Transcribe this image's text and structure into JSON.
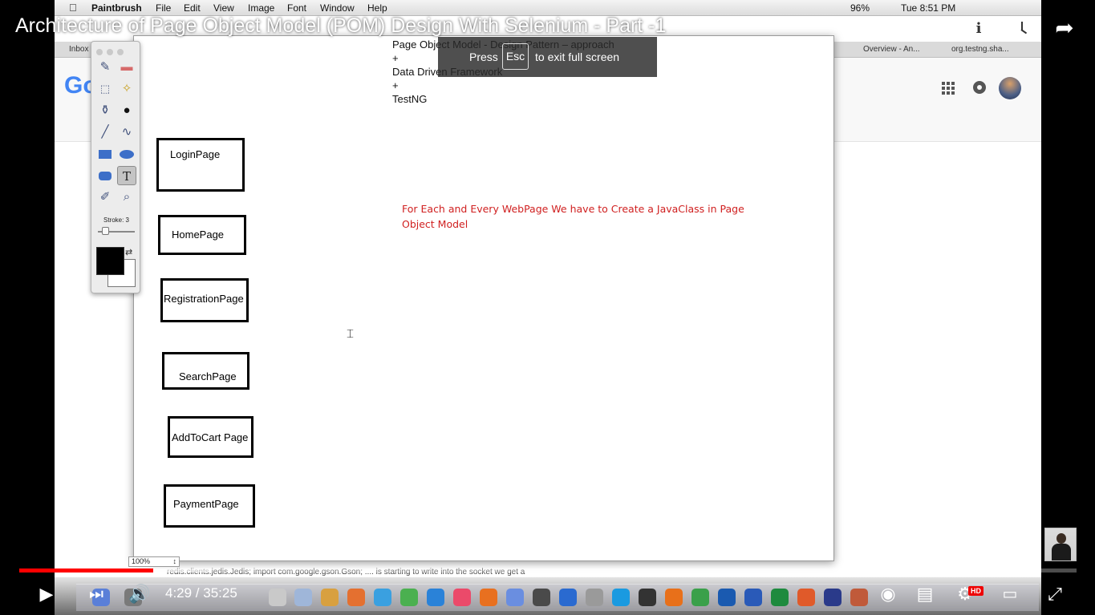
{
  "video_title": "Architecture of Page Object Model (POM) Design With Selenium - Part -1",
  "menubar": {
    "app": "Paintbrush",
    "menus": [
      "File",
      "Edit",
      "View",
      "Image",
      "Font",
      "Window",
      "Help"
    ],
    "battery": "96%",
    "clock": "Tue 8:51 PM"
  },
  "browser": {
    "tabs": [
      "Inbox",
      "Overview - An...",
      "org.testng.sha..."
    ],
    "logo": "Go"
  },
  "canvas": {
    "heading": "Page Object Model - Design Pattern – approach\n+\nData Driven Framework\n+\nTestNG",
    "boxes": [
      "LoginPage",
      "HomePage",
      "RegistrationPage",
      "SearchPage",
      "AddToCart Page",
      "PaymentPage"
    ],
    "note": "For Each and Every WebPage We have to Create a JavaClass in Page Object Model",
    "zoom": "100%",
    "bottom_text": "redis.clients.jedis.Jedis; import com.google.gson.Gson; .... is starting to write into the socket we get a"
  },
  "palette": {
    "stroke_label": "Stroke: 3",
    "tools": [
      "brush-icon",
      "eraser-icon",
      "select-rect-icon",
      "magic-wand-icon",
      "paint-bucket-icon",
      "bomb-icon",
      "line-icon",
      "curve-icon",
      "rectangle-icon",
      "ellipse-icon",
      "rounded-rect-icon",
      "text-tool-icon",
      "eyedropper-icon",
      "zoom-icon"
    ]
  },
  "esc_toast": {
    "pre": "Press",
    "key": "Esc",
    "post": "to exit full screen"
  },
  "player": {
    "current_time": "4:29",
    "duration": "35:25",
    "time_display": "4:29 / 35:25",
    "played_fraction": 0.127,
    "loaded_fraction": 0.182,
    "hd_badge": "HD",
    "accent": "#ff0000"
  }
}
